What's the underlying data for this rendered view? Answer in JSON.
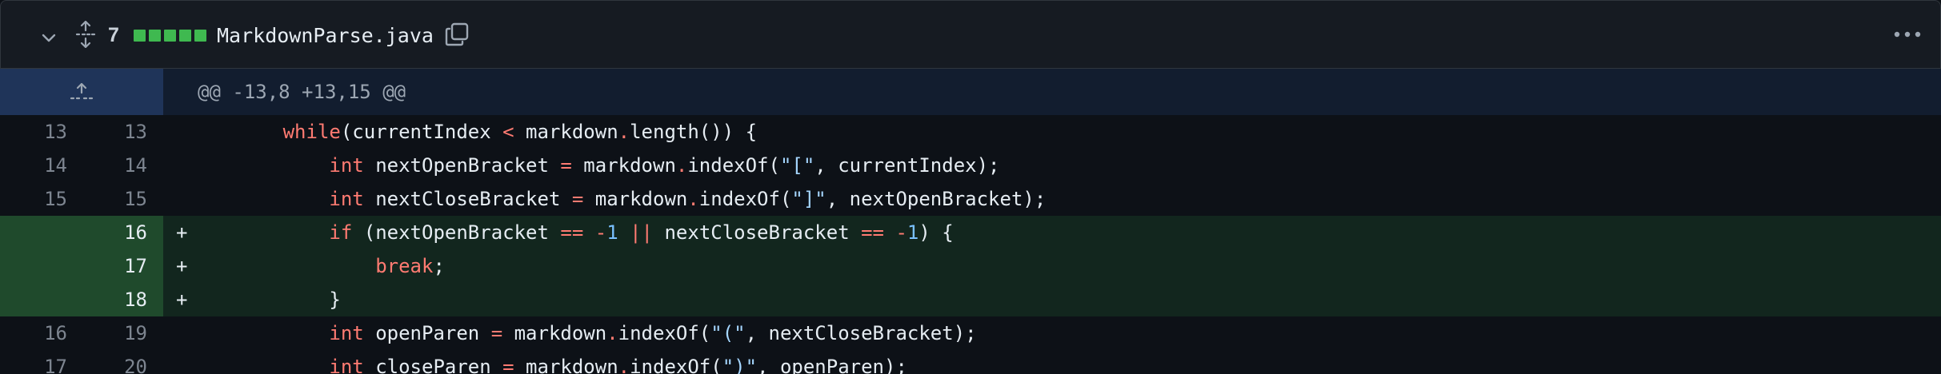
{
  "file_header": {
    "change_count": "7",
    "file_name": "MarkdownParse.java",
    "diffstat_blocks": 5,
    "colors": {
      "added": "#3fb950"
    },
    "icons": {
      "collapse": "chevron-down-icon",
      "expand": "unfold-icon",
      "copy": "copy-icon",
      "menu": "kebab-horizontal-icon"
    }
  },
  "hunk": {
    "header": "@@ -13,8 +13,15 @@",
    "expand_icon": "expand-up-icon"
  },
  "lines": [
    {
      "type": "context",
      "old": "13",
      "new": "13",
      "marker": "",
      "tokens": [
        {
          "t": "        ",
          "c": "plain"
        },
        {
          "t": "while",
          "c": "kw"
        },
        {
          "t": "(currentIndex ",
          "c": "plain"
        },
        {
          "t": "<",
          "c": "kw"
        },
        {
          "t": " markdown",
          "c": "plain"
        },
        {
          "t": ".",
          "c": "kw"
        },
        {
          "t": "length()) {",
          "c": "plain"
        }
      ]
    },
    {
      "type": "context",
      "old": "14",
      "new": "14",
      "marker": "",
      "tokens": [
        {
          "t": "            ",
          "c": "plain"
        },
        {
          "t": "int",
          "c": "kw"
        },
        {
          "t": " nextOpenBracket ",
          "c": "plain"
        },
        {
          "t": "=",
          "c": "kw"
        },
        {
          "t": " markdown",
          "c": "plain"
        },
        {
          "t": ".",
          "c": "kw"
        },
        {
          "t": "indexOf(",
          "c": "plain"
        },
        {
          "t": "\"[\"",
          "c": "str"
        },
        {
          "t": ", currentIndex);",
          "c": "plain"
        }
      ]
    },
    {
      "type": "context",
      "old": "15",
      "new": "15",
      "marker": "",
      "tokens": [
        {
          "t": "            ",
          "c": "plain"
        },
        {
          "t": "int",
          "c": "kw"
        },
        {
          "t": " nextCloseBracket ",
          "c": "plain"
        },
        {
          "t": "=",
          "c": "kw"
        },
        {
          "t": " markdown",
          "c": "plain"
        },
        {
          "t": ".",
          "c": "kw"
        },
        {
          "t": "indexOf(",
          "c": "plain"
        },
        {
          "t": "\"]\"",
          "c": "str"
        },
        {
          "t": ", nextOpenBracket);",
          "c": "plain"
        }
      ]
    },
    {
      "type": "added",
      "old": "",
      "new": "16",
      "marker": "+",
      "tokens": [
        {
          "t": "            ",
          "c": "plain"
        },
        {
          "t": "if",
          "c": "kw"
        },
        {
          "t": " (nextOpenBracket ",
          "c": "plain"
        },
        {
          "t": "==",
          "c": "kw"
        },
        {
          "t": " ",
          "c": "plain"
        },
        {
          "t": "-",
          "c": "kw"
        },
        {
          "t": "1",
          "c": "num"
        },
        {
          "t": " ",
          "c": "plain"
        },
        {
          "t": "||",
          "c": "kw"
        },
        {
          "t": " nextCloseBracket ",
          "c": "plain"
        },
        {
          "t": "==",
          "c": "kw"
        },
        {
          "t": " ",
          "c": "plain"
        },
        {
          "t": "-",
          "c": "kw"
        },
        {
          "t": "1",
          "c": "num"
        },
        {
          "t": ") {",
          "c": "plain"
        }
      ]
    },
    {
      "type": "added",
      "old": "",
      "new": "17",
      "marker": "+",
      "tokens": [
        {
          "t": "                ",
          "c": "plain"
        },
        {
          "t": "break",
          "c": "kw"
        },
        {
          "t": ";",
          "c": "plain"
        }
      ]
    },
    {
      "type": "added",
      "old": "",
      "new": "18",
      "marker": "+",
      "tokens": [
        {
          "t": "            }",
          "c": "plain"
        }
      ]
    },
    {
      "type": "context",
      "old": "16",
      "new": "19",
      "marker": "",
      "tokens": [
        {
          "t": "            ",
          "c": "plain"
        },
        {
          "t": "int",
          "c": "kw"
        },
        {
          "t": " openParen ",
          "c": "plain"
        },
        {
          "t": "=",
          "c": "kw"
        },
        {
          "t": " markdown",
          "c": "plain"
        },
        {
          "t": ".",
          "c": "kw"
        },
        {
          "t": "indexOf(",
          "c": "plain"
        },
        {
          "t": "\"(\"",
          "c": "str"
        },
        {
          "t": ", nextCloseBracket);",
          "c": "plain"
        }
      ]
    },
    {
      "type": "context",
      "old": "17",
      "new": "20",
      "marker": "",
      "tokens": [
        {
          "t": "            ",
          "c": "plain"
        },
        {
          "t": "int",
          "c": "kw"
        },
        {
          "t": " closeParen ",
          "c": "plain"
        },
        {
          "t": "=",
          "c": "kw"
        },
        {
          "t": " markdown",
          "c": "plain"
        },
        {
          "t": ".",
          "c": "kw"
        },
        {
          "t": "indexOf(",
          "c": "plain"
        },
        {
          "t": "\")\"",
          "c": "str"
        },
        {
          "t": ", openParen);",
          "c": "plain"
        }
      ]
    }
  ]
}
